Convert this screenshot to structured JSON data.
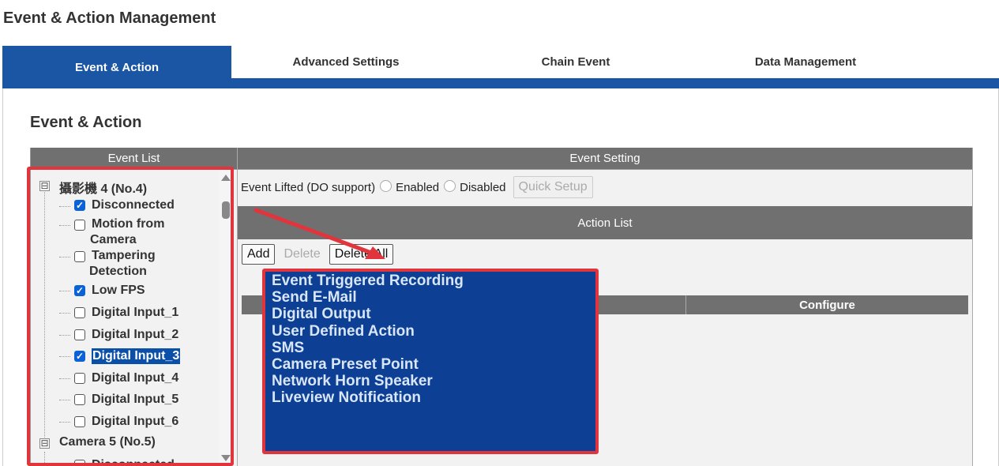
{
  "app": {
    "title": "Event & Action Management"
  },
  "tabs": [
    {
      "label": "Event & Action",
      "active": true
    },
    {
      "label": "Advanced Settings",
      "active": false
    },
    {
      "label": "Chain Event",
      "active": false
    },
    {
      "label": "Data Management",
      "active": false
    }
  ],
  "section": {
    "title": "Event & Action"
  },
  "event_list": {
    "header": "Event List",
    "camera_4": {
      "label": "攝影機 4 (No.4)",
      "expander": "⊟"
    },
    "items": [
      {
        "label": "Disconnected",
        "checked": true
      },
      {
        "label_line1": "Motion from",
        "label_line2": "Camera",
        "checked": false
      },
      {
        "label_line1": "Tampering",
        "label_line2": "Detection",
        "checked": false
      },
      {
        "label": "Low FPS",
        "checked": true
      },
      {
        "label": "Digital Input_1",
        "checked": false
      },
      {
        "label": "Digital Input_2",
        "checked": false
      },
      {
        "label": "Digital Input_3",
        "checked": true,
        "selected": true
      },
      {
        "label": "Digital Input_4",
        "checked": false
      },
      {
        "label": "Digital Input_5",
        "checked": false
      },
      {
        "label": "Digital Input_6",
        "checked": false
      }
    ],
    "camera_5": {
      "label": "Camera 5 (No.5)",
      "expander": "⊟",
      "partial_item": "Disconnected"
    }
  },
  "event_setting": {
    "header": "Event Setting",
    "event_lifted_label": "Event Lifted (DO support)",
    "enabled_label": "Enabled",
    "disabled_label": "Disabled",
    "quick_setup_label": "Quick Setup"
  },
  "action_list": {
    "header": "Action List",
    "add_label": "Add",
    "delete_label": "Delete",
    "delete_all_label": "Delete All",
    "column_configure": "Configure"
  },
  "action_dropdown": {
    "options": [
      "Event Triggered Recording",
      "Send E-Mail",
      "Digital Output",
      "User Defined Action",
      "SMS",
      "Camera Preset Point",
      "Network Horn Speaker",
      "Liveview Notification"
    ]
  },
  "colors": {
    "accent_blue": "#1a56a3",
    "header_gray": "#707070",
    "highlight_red": "#e0353d",
    "dropdown_bg": "#0d3f94",
    "checkbox_blue": "#0b62d6"
  }
}
